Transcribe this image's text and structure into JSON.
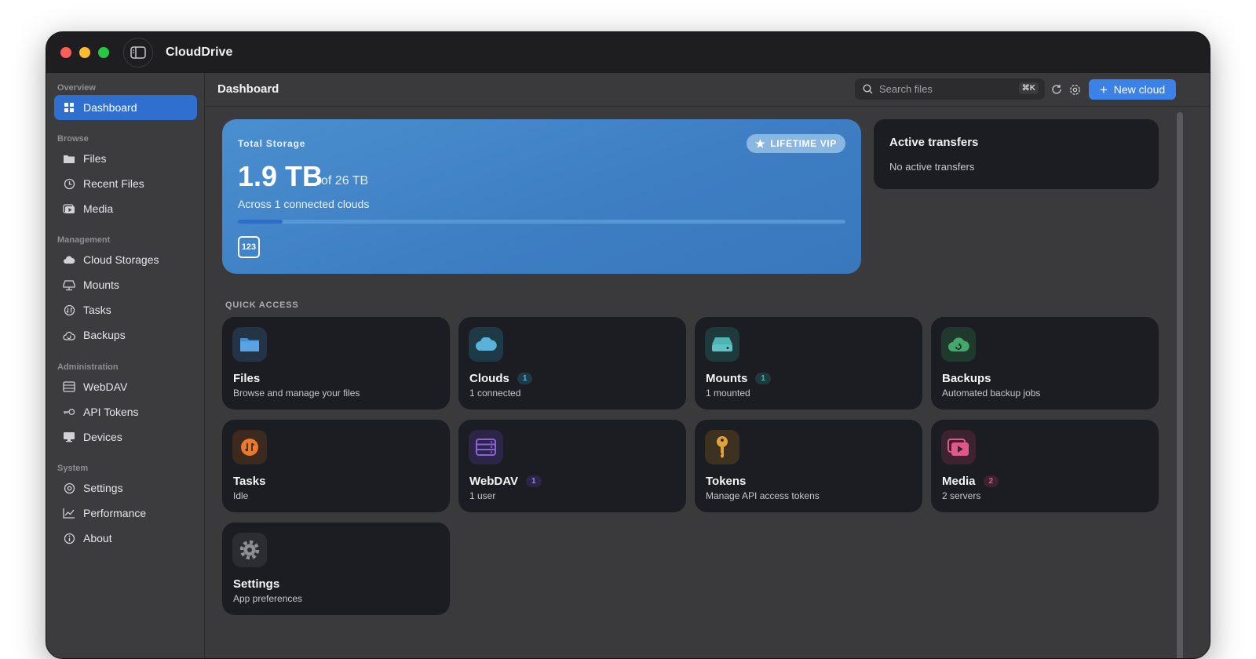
{
  "window": {
    "title": "CloudDrive"
  },
  "sidebar": {
    "sections": [
      {
        "label": "Overview"
      },
      {
        "label": "Browse"
      },
      {
        "label": "Management"
      },
      {
        "label": "Administration"
      },
      {
        "label": "System"
      }
    ],
    "items": [
      {
        "label": "Dashboard",
        "icon": "dashboard-icon",
        "active": true
      },
      {
        "label": "Files",
        "icon": "folder-icon"
      },
      {
        "label": "Recent Files",
        "icon": "clock-icon"
      },
      {
        "label": "Media",
        "icon": "media-icon"
      },
      {
        "label": "Cloud Storages",
        "icon": "cloud-icon"
      },
      {
        "label": "Mounts",
        "icon": "drive-icon"
      },
      {
        "label": "Tasks",
        "icon": "tasks-icon"
      },
      {
        "label": "Backups",
        "icon": "backup-icon"
      },
      {
        "label": "WebDAV",
        "icon": "server-icon"
      },
      {
        "label": "API Tokens",
        "icon": "key-icon"
      },
      {
        "label": "Devices",
        "icon": "monitor-icon"
      },
      {
        "label": "Settings",
        "icon": "gear-icon"
      },
      {
        "label": "Performance",
        "icon": "chart-icon"
      },
      {
        "label": "About",
        "icon": "info-icon"
      }
    ]
  },
  "header": {
    "title": "Dashboard",
    "search_placeholder": "Search files",
    "search_shortcut": "⌘K",
    "new_cloud_label": "New cloud"
  },
  "storage": {
    "label": "Total Storage",
    "used": "1.9 TB",
    "total": "of 26 TB",
    "subtitle": "Across 1 connected clouds",
    "badge": "LIFETIME VIP",
    "usage_fraction": 0.073,
    "provider_logo_text": "123"
  },
  "transfers": {
    "title": "Active transfers",
    "status": "No active transfers"
  },
  "quick_access": {
    "label": "QUICK ACCESS",
    "cards": [
      {
        "title": "Files",
        "subtitle": "Browse and manage your files",
        "badge": "",
        "icon": "folder-icon",
        "color": "#3f8fd6"
      },
      {
        "title": "Clouds",
        "subtitle": "1 connected",
        "badge": "1",
        "icon": "cloud-icon",
        "color": "#5ab2d8"
      },
      {
        "title": "Mounts",
        "subtitle": "1 mounted",
        "badge": "1",
        "icon": "drive-icon",
        "color": "#4fb3b3"
      },
      {
        "title": "Backups",
        "subtitle": "Automated backup jobs",
        "badge": "",
        "icon": "cloud-sync-icon",
        "color": "#43a86a"
      },
      {
        "title": "Tasks",
        "subtitle": "Idle",
        "badge": "",
        "icon": "arrows-icon",
        "color": "#e8792e"
      },
      {
        "title": "WebDAV",
        "subtitle": "1 user",
        "badge": "1",
        "icon": "server-icon",
        "color": "#8a63d6"
      },
      {
        "title": "Tokens",
        "subtitle": "Manage API access tokens",
        "badge": "",
        "icon": "key-icon",
        "color": "#e0a43a"
      },
      {
        "title": "Media",
        "subtitle": "2 servers",
        "badge": "2",
        "icon": "media-icon",
        "color": "#e0588a"
      },
      {
        "title": "Settings",
        "subtitle": "App preferences",
        "badge": "",
        "icon": "gear-icon",
        "color": "#8e8e93"
      }
    ]
  }
}
